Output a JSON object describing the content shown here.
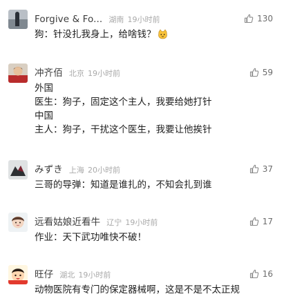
{
  "comments": [
    {
      "username": "Forgive & Fo...",
      "location": "湖南",
      "time": "19小时前",
      "likes": "130",
      "lines": [
        "狗：针没扎我身上，给啥钱？"
      ],
      "emoji": "cat-face-emoji"
    },
    {
      "username": "冲齐佰",
      "location": "北京",
      "time": "19小时前",
      "likes": "59",
      "lines": [
        "外国",
        "医生：狗子，固定这个主人，我要给她打针",
        "中国",
        "主人：狗子，干扰这个医生，我要让他挨针"
      ]
    },
    {
      "username": "みずき",
      "location": "上海",
      "time": "20小时前",
      "likes": "37",
      "lines": [
        "三哥的导弹：知道是谁扎的，不知会扎到谁"
      ]
    },
    {
      "username": "远看姑娘近看牛",
      "location": "辽宁",
      "time": "19小时前",
      "likes": "17",
      "lines": [
        "作业：天下武功唯快不破！"
      ]
    },
    {
      "username": "旺仔",
      "location": "湖北",
      "time": "19小时前",
      "likes": "16",
      "lines": [
        "动物医院有专门的保定器械啊，这是不是不太正规"
      ]
    }
  ],
  "icons": {
    "like": "thumbs-up-outline-icon"
  },
  "colors": {
    "username": "#3c3c3c",
    "meta": "#a9a9a9",
    "content": "#1e1e1e",
    "likeCount": "#6c6c6c"
  }
}
